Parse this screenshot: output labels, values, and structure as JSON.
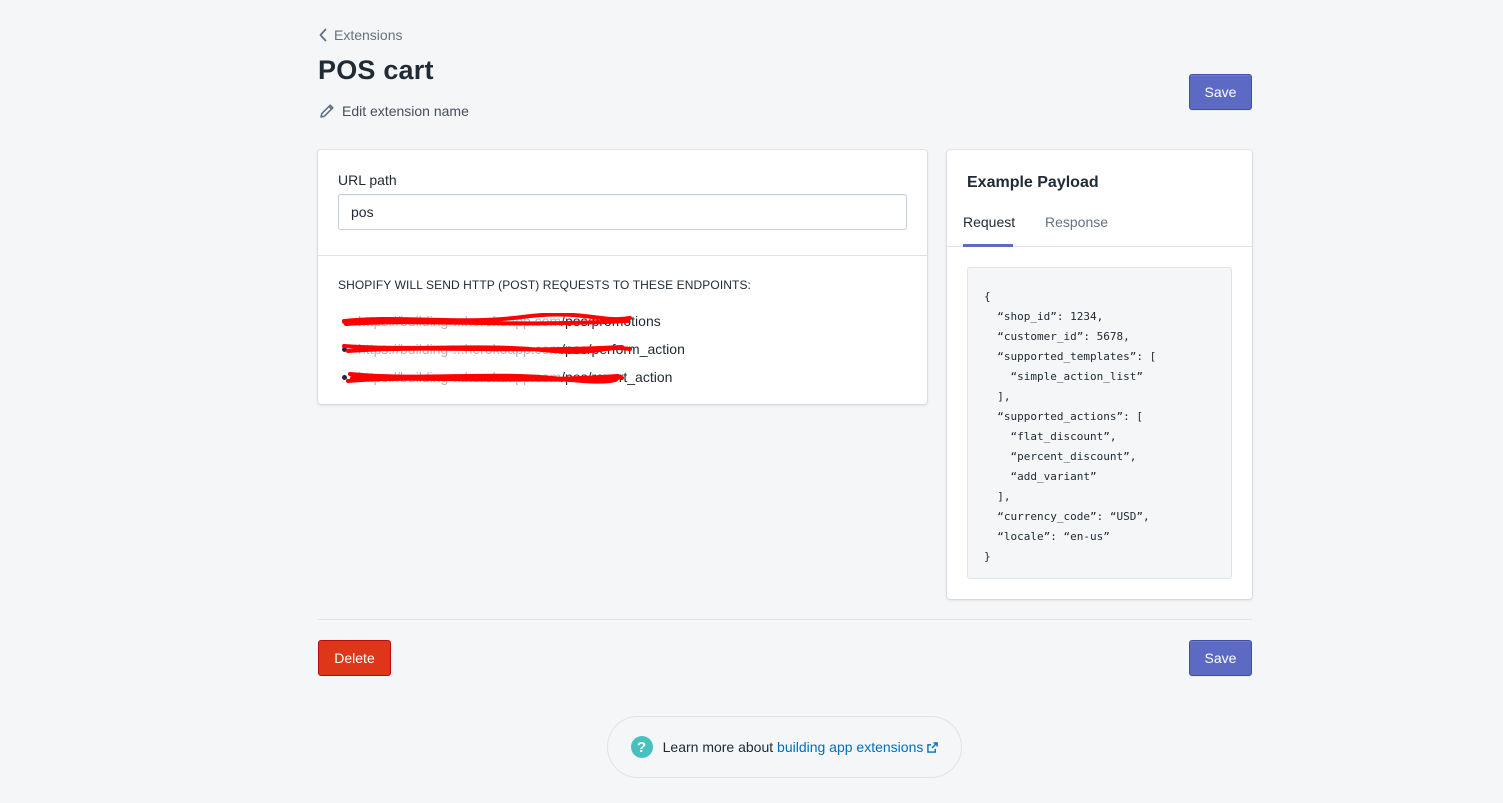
{
  "breadcrumb": {
    "label": "Extensions",
    "icon": "chevron-left-icon"
  },
  "page": {
    "title": "POS cart",
    "edit_label": "Edit extension name",
    "edit_icon": "pencil-icon"
  },
  "actions": {
    "save_label": "Save",
    "delete_label": "Delete"
  },
  "url_card": {
    "label": "URL path",
    "value": "pos",
    "endpoints_heading": "SHOPIFY WILL SEND HTTP (POST) REQUESTS TO THESE ENDPOINTS:",
    "endpoints": [
      {
        "host": "https://building-...herokuapp.com",
        "path": "/pos/promotions"
      },
      {
        "host": "https://building-...herokuapp.com",
        "path": "/pos/perform_action"
      },
      {
        "host": "https://building-...herokuapp.com",
        "path": "/pos/revert_action"
      }
    ]
  },
  "payload_card": {
    "title": "Example Payload",
    "tabs": [
      {
        "label": "Request"
      },
      {
        "label": "Response"
      }
    ],
    "active_tab": "Request",
    "code": "{\n  “shop_id”: 1234,\n  “customer_id”: 5678,\n  “supported_templates”: [\n    “simple_action_list”\n  ],\n  “supported_actions”: [\n    “flat_discount”,\n    “percent_discount”,\n    “add_variant”\n  ],\n  “currency_code”: “USD”,\n  “locale”: “en-us”\n}"
  },
  "help": {
    "prefix": "Learn more about ",
    "link": "building app extensions",
    "icon": "question-icon",
    "link_icon": "external-link-icon"
  },
  "colors": {
    "primary": "#5c6ac4",
    "danger": "#de3618",
    "help_icon": "#47c1bf",
    "link": "#006fbb",
    "redaction": "#ff0000"
  }
}
